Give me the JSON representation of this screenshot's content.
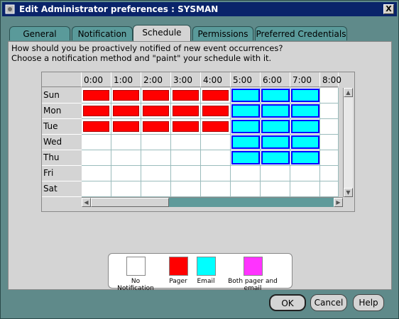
{
  "window": {
    "title": "Edit Administrator preferences : SYSMAN",
    "close_label": "X"
  },
  "tabs": [
    {
      "label": "General"
    },
    {
      "label": "Notification"
    },
    {
      "label": "Schedule",
      "active": true
    },
    {
      "label": "Permissions"
    },
    {
      "label": "Preferred Credentials"
    }
  ],
  "instructions": {
    "line1": "How should you be proactively notified of new event occurrences?",
    "line2": "Choose a notification method and \"paint\" your schedule with it."
  },
  "schedule": {
    "hours": [
      "0:00",
      "1:00",
      "2:00",
      "3:00",
      "4:00",
      "5:00",
      "6:00",
      "7:00",
      "8:00"
    ],
    "days": [
      "Sun",
      "Mon",
      "Tue",
      "Wed",
      "Thu",
      "Fri",
      "Sat"
    ],
    "rows": [
      [
        "pager",
        "pager",
        "pager",
        "pager",
        "pager",
        "email",
        "email",
        "email",
        "none"
      ],
      [
        "pager",
        "pager",
        "pager",
        "pager",
        "pager",
        "email",
        "email",
        "email",
        "none"
      ],
      [
        "pager",
        "pager",
        "pager",
        "pager",
        "pager",
        "email",
        "email",
        "email",
        "none"
      ],
      [
        "none",
        "none",
        "none",
        "none",
        "none",
        "email",
        "email",
        "email",
        "none"
      ],
      [
        "none",
        "none",
        "none",
        "none",
        "none",
        "email",
        "email",
        "email",
        "none"
      ],
      [
        "none",
        "none",
        "none",
        "none",
        "none",
        "none",
        "none",
        "none",
        "none"
      ],
      [
        "none",
        "none",
        "none",
        "none",
        "none",
        "none",
        "none",
        "none",
        "none"
      ]
    ]
  },
  "legend": [
    {
      "label": "No Notification",
      "color": "#ffffff"
    },
    {
      "label": "Pager",
      "color": "#ff0000"
    },
    {
      "label": "Email",
      "color": "#00ffff"
    },
    {
      "label": "Both pager and email",
      "color": "#ff33ff"
    }
  ],
  "buttons": {
    "ok": "OK",
    "cancel": "Cancel",
    "help": "Help"
  },
  "colors": {
    "titlebar": "#0a246a",
    "pager": "#ff0000",
    "email": "#00ffff",
    "email_border": "#0000ff",
    "both": "#ff33ff"
  }
}
